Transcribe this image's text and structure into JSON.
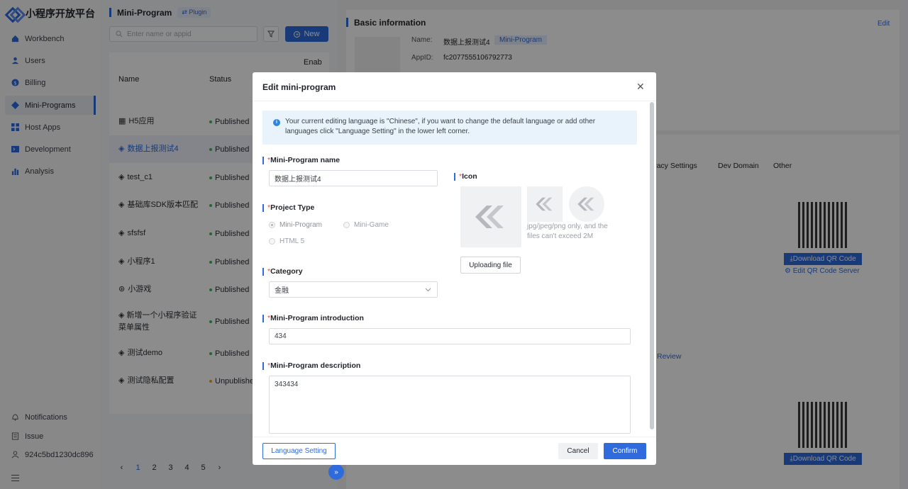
{
  "app": {
    "logo_text": "小程序开放平台"
  },
  "sidebar": {
    "items": [
      {
        "label": "Workbench",
        "icon": "home-icon"
      },
      {
        "label": "Users",
        "icon": "user-icon"
      },
      {
        "label": "Billing",
        "icon": "billing-icon"
      },
      {
        "label": "Mini-Programs",
        "icon": "mini-program-icon",
        "active": true
      },
      {
        "label": "Host Apps",
        "icon": "grid-icon"
      },
      {
        "label": "Development",
        "icon": "code-icon"
      },
      {
        "label": "Analysis",
        "icon": "bar-chart-icon"
      }
    ],
    "bottom": [
      {
        "label": "Notifications",
        "icon": "bell-icon"
      },
      {
        "label": "Issue",
        "icon": "issue-icon"
      },
      {
        "label": "924c5bd1230dc896",
        "icon": "avatar-icon"
      }
    ]
  },
  "list": {
    "title": "Mini-Program",
    "plugin_label": "Plugin",
    "search_placeholder": "Enter name or appid",
    "new_label": "New",
    "columns": {
      "name": "Name",
      "status": "Status",
      "enabled": "Enab"
    },
    "rows": [
      {
        "name": "H5应用",
        "status": "Published"
      },
      {
        "name": "数据上报测试4",
        "status": "Published"
      },
      {
        "name": "test_c1",
        "status": "Published"
      },
      {
        "name": "基础库SDK版本匹配",
        "status": "Published"
      },
      {
        "name": "sfsfsf",
        "status": "Published"
      },
      {
        "name": "小程序1",
        "status": "Published"
      },
      {
        "name": "小游戏",
        "status": "Published"
      },
      {
        "name": "新增一个小程序验证",
        "name2": "菜单属性",
        "status": "Published"
      },
      {
        "name": "测试demo",
        "status": "Published"
      },
      {
        "name": "测试隐私配置",
        "status": "Unpublished"
      }
    ],
    "pages": [
      "1",
      "2",
      "3",
      "4",
      "5"
    ]
  },
  "detail": {
    "section_title": "Basic information",
    "edit_label": "Edit",
    "name_label": "Name:",
    "name_value": "数据上报测试4",
    "type_badge": "Mini-Program",
    "appid_label": "AppID:",
    "appid_value": "fc2077555106792773",
    "tabs": [
      "ivacy Settings",
      "Dev Domain",
      "Other"
    ],
    "download_qr": "Download QR Code",
    "edit_qr_server": "Edit QR Code Server",
    "review": "Review"
  },
  "modal": {
    "title": "Edit mini-program",
    "notice": "Your current editing language is \"Chinese\", if you want to change the default language or add other languages click \"Language Setting\" in the lower left corner.",
    "name_label": "Mini-Program name",
    "name_value": "数据上报测试4",
    "project_type_label": "Project Type",
    "project_types": [
      "Mini-Program",
      "Mini-Game",
      "HTML 5"
    ],
    "category_label": "Category",
    "category_value": "金融",
    "intro_label": "Mini-Program introduction",
    "intro_value": "434",
    "desc_label": "Mini-Program description",
    "desc_value": "343434",
    "icon_label": "Icon",
    "icon_hint": "jpg/jpeg/png only, and the files can't exceed 2M",
    "upload_label": "Uploading file",
    "language_setting": "Language Setting",
    "cancel": "Cancel",
    "confirm": "Confirm",
    "required_mark": "*"
  },
  "colors": {
    "accent": "#2f6bdc",
    "published": "#3fb950",
    "unpublished": "#f0a020"
  }
}
